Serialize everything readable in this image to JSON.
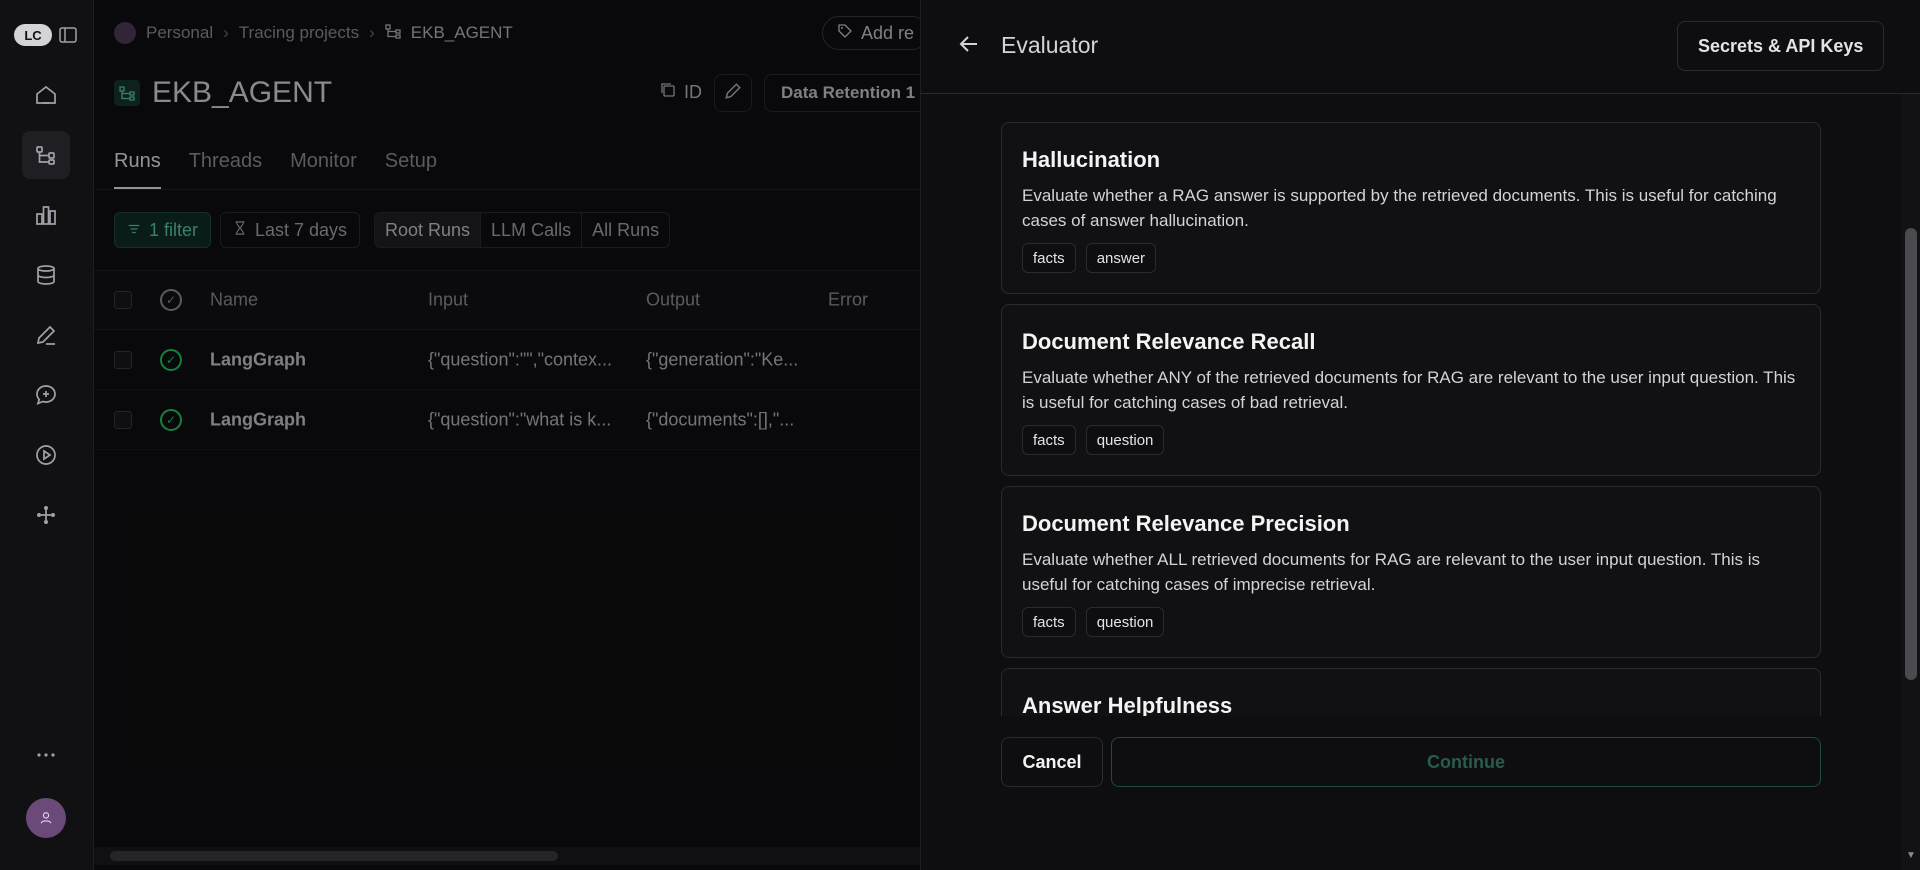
{
  "app": {
    "logo_text": "LC"
  },
  "sidebar": {
    "icons": [
      "home-icon",
      "tracing-icon",
      "dashboards-icon",
      "datasets-icon",
      "annotation-icon",
      "prompts-icon",
      "deployments-icon",
      "studio-icon",
      "more-icon"
    ]
  },
  "breadcrumb": {
    "workspace": "Personal",
    "section": "Tracing projects",
    "project": "EKB_AGENT"
  },
  "header": {
    "add_button": "Add re",
    "project_title": "EKB_AGENT",
    "id_label": "ID",
    "data_retention": "Data Retention 1"
  },
  "tabs": [
    "Runs",
    "Threads",
    "Monitor",
    "Setup"
  ],
  "filters": {
    "filter": "1 filter",
    "time_range": "Last 7 days",
    "run_types": [
      "Root Runs",
      "LLM Calls",
      "All Runs"
    ]
  },
  "table": {
    "columns": {
      "name": "Name",
      "input": "Input",
      "output": "Output",
      "error": "Error"
    },
    "rows": [
      {
        "name": "LangGraph",
        "input": "{\"question\":\"\",\"contex...",
        "output": "{\"generation\":\"Ke..."
      },
      {
        "name": "LangGraph",
        "input": "{\"question\":\"what is k...",
        "output": "{\"documents\":[],\"..."
      }
    ]
  },
  "drawer": {
    "title": "Evaluator",
    "secrets_button": "Secrets & API Keys",
    "cards": [
      {
        "title": "Hallucination",
        "description": "Evaluate whether a RAG answer is supported by the retrieved documents. This is useful for catching cases of answer hallucination.",
        "tags": [
          "facts",
          "answer"
        ]
      },
      {
        "title": "Document Relevance Recall",
        "description": "Evaluate whether ANY of the retrieved documents for RAG are relevant to the user input question. This is useful for catching cases of bad retrieval.",
        "tags": [
          "facts",
          "question"
        ]
      },
      {
        "title": "Document Relevance Precision",
        "description": "Evaluate whether ALL retrieved documents for RAG are relevant to the user input question. This is useful for catching cases of imprecise retrieval.",
        "tags": [
          "facts",
          "question"
        ]
      },
      {
        "title": "Answer Helpfulness",
        "description": "",
        "tags": []
      }
    ],
    "cancel": "Cancel",
    "continue": "Continue"
  },
  "colors": {
    "accent": "#5ec3a6",
    "success": "#22c55e",
    "background": "#0e0e10"
  }
}
